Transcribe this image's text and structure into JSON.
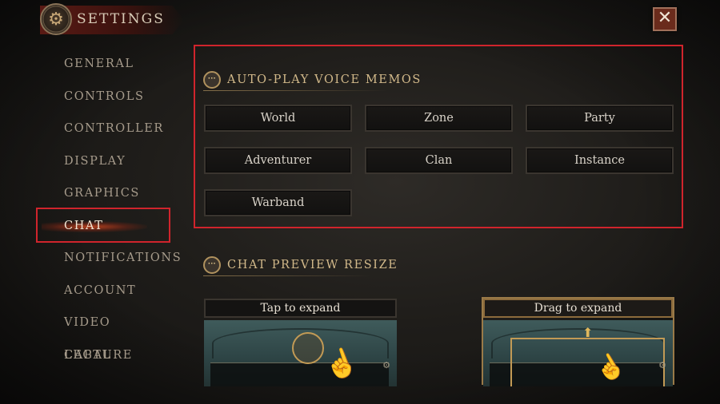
{
  "header": {
    "title": "SETTINGS",
    "icon": "gear-icon",
    "close_label": "✕"
  },
  "sidebar": {
    "items": [
      {
        "label": "GENERAL"
      },
      {
        "label": "CONTROLS"
      },
      {
        "label": "CONTROLLER"
      },
      {
        "label": "DISPLAY"
      },
      {
        "label": "GRAPHICS"
      },
      {
        "label": "CHAT",
        "active": true
      },
      {
        "label": "NOTIFICATIONS"
      },
      {
        "label": "ACCOUNT"
      },
      {
        "label": "VIDEO CAPTURE"
      },
      {
        "label": "LEGAL"
      }
    ]
  },
  "memos": {
    "title": "AUTO-PLAY VOICE MEMOS",
    "icon": "chat-bubble-icon",
    "buttons": [
      "World",
      "Zone",
      "Party",
      "Adventurer",
      "Clan",
      "Instance",
      "Warband"
    ]
  },
  "preview": {
    "title": "CHAT PREVIEW RESIZE",
    "icon": "chat-bubble-icon",
    "options": [
      {
        "label": "Tap to expand",
        "selected": false
      },
      {
        "label": "Drag to expand",
        "selected": true
      }
    ]
  },
  "colors": {
    "accent_red": "#d0242c",
    "gold": "#d2b98a",
    "active_glow": "#d2461e"
  }
}
